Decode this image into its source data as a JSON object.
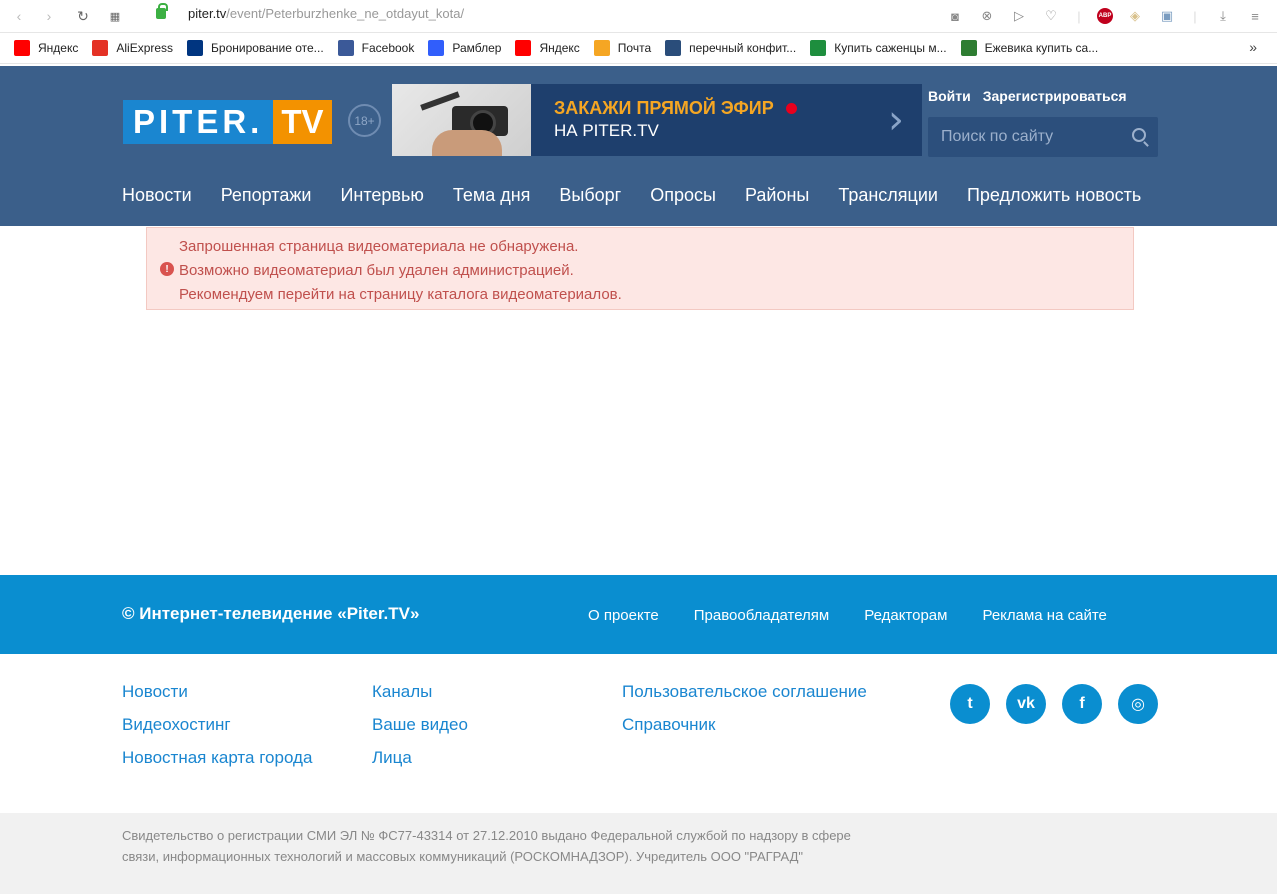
{
  "browser": {
    "url_host": "piter.tv",
    "url_path": "/event/Peterburzhenke_ne_otdayut_kota/",
    "bookmarks": [
      {
        "label": "Яндекс",
        "icon": "yandex-icon",
        "color": "#ff0000"
      },
      {
        "label": "AliExpress",
        "icon": "aliexpress-icon",
        "color": "#e43225"
      },
      {
        "label": "Бронирование оте...",
        "icon": "booking-icon",
        "color": "#003580"
      },
      {
        "label": "Facebook",
        "icon": "facebook-icon",
        "color": "#3b5998"
      },
      {
        "label": "Рамблер",
        "icon": "rambler-icon",
        "color": "#315efb"
      },
      {
        "label": "Яндекс",
        "icon": "yandex-icon",
        "color": "#ff0000"
      },
      {
        "label": "Почта",
        "icon": "mail-icon",
        "color": "#f5a623"
      },
      {
        "label": "перечный конфит...",
        "icon": "recipe-icon",
        "color": "#2a4d7a"
      },
      {
        "label": "Купить саженцы м...",
        "icon": "b-icon",
        "color": "#1e8e3e"
      },
      {
        "label": "Ежевика купить са...",
        "icon": "tree-icon",
        "color": "#2e7d32"
      }
    ],
    "abp_label": "ABP"
  },
  "header": {
    "logo_part1": "PITER.",
    "logo_part2": "TV",
    "age_badge": "18+",
    "banner_line1": "ЗАКАЖИ ПРЯМОЙ ЭФИР",
    "banner_line2": "НА PITER.TV",
    "login": "Войти",
    "register": "Зарегистрироваться",
    "search_placeholder": "Поиск по сайту",
    "nav": [
      "Новости",
      "Репортажи",
      "Интервью",
      "Тема дня",
      "Выборг",
      "Опросы",
      "Районы",
      "Трансляции",
      "Предложить новость"
    ]
  },
  "alert": {
    "icon_symbol": "!",
    "lines": [
      "Запрошенная страница видеоматериала не обнаружена.",
      "Возможно видеоматериал был удален администрацией.",
      "Рекомендуем перейти на страницу каталога видеоматериалов."
    ]
  },
  "footer": {
    "copyright": "© Интернет-телевидение «Piter.TV»",
    "links": [
      "О проекте",
      "Правообладателям",
      "Редакторам",
      "Реклама на сайте"
    ],
    "col1": [
      "Новости",
      "Видеохостинг",
      "Новостная карта города"
    ],
    "col2": [
      "Каналы",
      "Ваше видео",
      "Лица"
    ],
    "col3": [
      "Пользовательское соглашение",
      "Справочник"
    ],
    "socials": [
      {
        "icon": "twitter-icon",
        "glyph": "t"
      },
      {
        "icon": "vk-icon",
        "glyph": "vk"
      },
      {
        "icon": "facebook-icon",
        "glyph": "f"
      },
      {
        "icon": "instagram-icon",
        "glyph": "◎"
      }
    ],
    "legal_line1": "Свидетельство о регистрации СМИ ЭЛ № ФС77-43314 от 27.12.2010 выдано Федеральной службой по надзору в сфере",
    "legal_line2": "связи, информационных технологий и массовых коммуникаций (РОСКОМНАДЗОР). Учредитель ООО \"РАГРАД\""
  },
  "colors": {
    "header_bg": "#3b5f8a",
    "footer_blue": "#0a8ed0",
    "link_blue": "#1a86d0",
    "alert_text": "#c0504d",
    "banner_accent": "#f5a623"
  }
}
